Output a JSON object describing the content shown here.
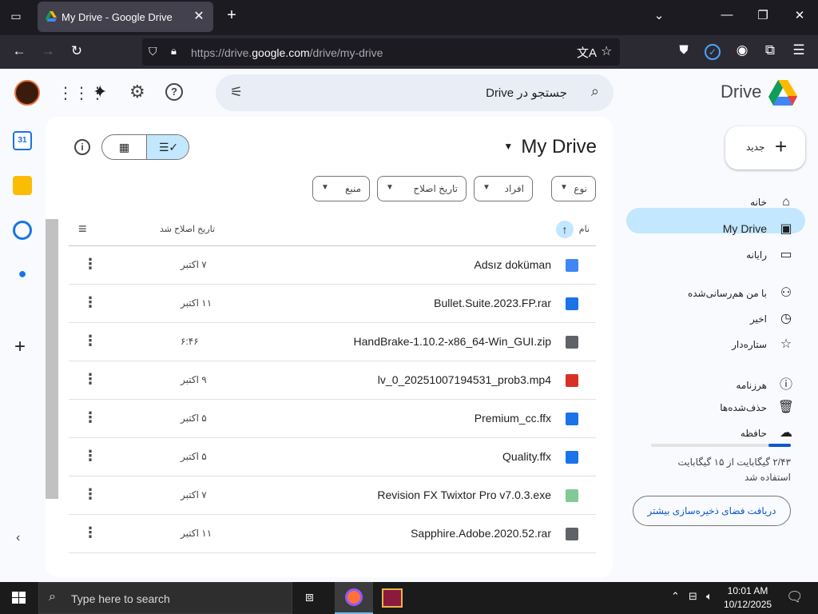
{
  "browser": {
    "tab_title": "My Drive - Google Drive",
    "url_prefix": "https://drive.",
    "url_domain": "google.com",
    "url_path": "/drive/my-drive"
  },
  "header": {
    "search_placeholder": "جستجو در Drive",
    "brand": "Drive"
  },
  "main": {
    "title": "My Drive",
    "filters": [
      "نوع",
      "افراد",
      "تاریخ اصلاح",
      "منبع"
    ],
    "col_name": "نام",
    "col_modified": "تاریخ اصلاح شد",
    "files": [
      {
        "name": "Adsız doküman",
        "date": "۷ اکتبر",
        "icon": "docs-icon",
        "color": "#4285f4"
      },
      {
        "name": "Bullet.Suite.2023.FP.rar",
        "date": "۱۱ اکتبر",
        "icon": "file-icon",
        "color": "#1a73e8"
      },
      {
        "name": "HandBrake-1.10.2-x86_64-Win_GUI.zip",
        "date": "۶:۴۶",
        "icon": "archive-icon",
        "color": "#5f6368"
      },
      {
        "name": "lv_0_20251007194531_prob3.mp4",
        "date": "۹ اکتبر",
        "icon": "video-icon",
        "color": "#d93025"
      },
      {
        "name": "Premium_cc.ffx",
        "date": "۵ اکتبر",
        "icon": "file-icon",
        "color": "#1a73e8"
      },
      {
        "name": "Quality.ffx",
        "date": "۵ اکتبر",
        "icon": "file-icon",
        "color": "#1a73e8"
      },
      {
        "name": "Revision FX Twixtor Pro v7.0.3.exe",
        "date": "۷ اکتبر",
        "icon": "exe-icon",
        "color": "#81c995"
      },
      {
        "name": "Sapphire.Adobe.2020.52.rar",
        "date": "۱۱ اکتبر",
        "icon": "archive-icon",
        "color": "#5f6368"
      }
    ]
  },
  "sidebar": {
    "new_label": "جدید",
    "items": [
      {
        "label": "خانه",
        "icon": "home-icon"
      },
      {
        "label": "My Drive",
        "icon": "drive-icon"
      },
      {
        "label": "رایانه",
        "icon": "computer-icon"
      },
      {
        "label": "با من هم‌رسانی‌شده",
        "icon": "shared-icon"
      },
      {
        "label": "اخیر",
        "icon": "clock-icon"
      },
      {
        "label": "ستاره‌دار",
        "icon": "star-icon"
      },
      {
        "label": "هرزنامه",
        "icon": "spam-icon"
      },
      {
        "label": "حذف‌شده‌ها",
        "icon": "trash-icon"
      },
      {
        "label": "حافظه",
        "icon": "cloud-icon"
      }
    ],
    "storage_text": "۲/۴۳ گیگابایت از ۱۵ گیگابایت استفاده شد",
    "storage_fraction": 0.16,
    "storage_button": "دریافت فضای ذخیره‌سازی بیشتر"
  },
  "taskbar": {
    "search_placeholder": "Type here to search",
    "time": "10:01 AM",
    "date": "10/12/2025"
  }
}
